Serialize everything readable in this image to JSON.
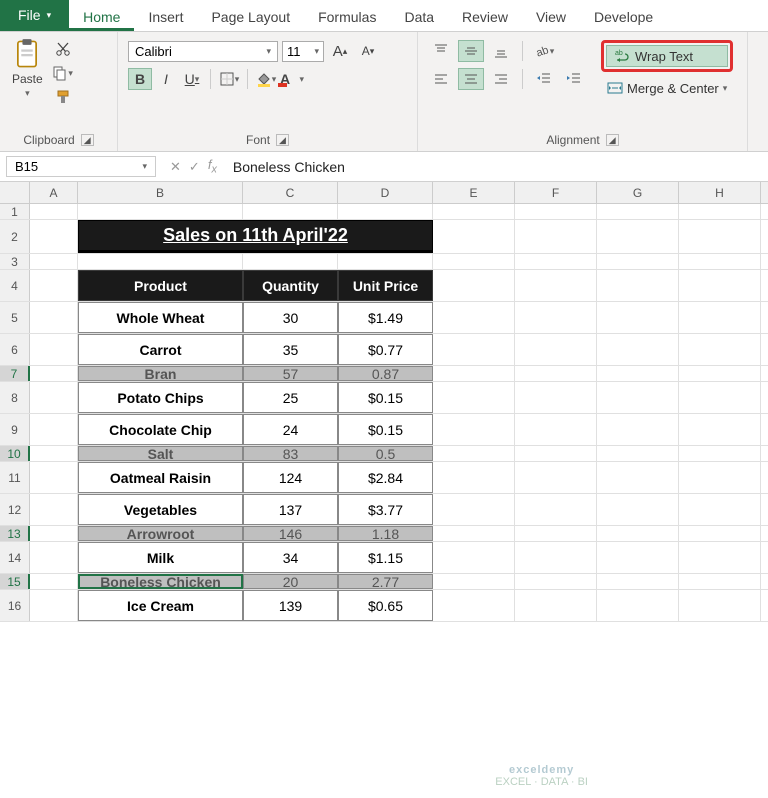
{
  "tabs": {
    "file": "File",
    "home": "Home",
    "insert": "Insert",
    "pagelayout": "Page Layout",
    "formulas": "Formulas",
    "data": "Data",
    "review": "Review",
    "view": "View",
    "developer": "Develope"
  },
  "ribbon": {
    "clipboard": {
      "paste": "Paste",
      "label": "Clipboard"
    },
    "font": {
      "name": "Calibri",
      "size": "11",
      "label": "Font"
    },
    "alignment": {
      "wrap": "Wrap Text",
      "merge": "Merge & Center",
      "label": "Alignment"
    }
  },
  "fbar": {
    "cellref": "B15",
    "formula": "Boneless Chicken"
  },
  "cols": [
    "A",
    "B",
    "C",
    "D",
    "E",
    "F",
    "G",
    "H"
  ],
  "title": "Sales on 11th April'22",
  "headers": {
    "product": "Product",
    "qty": "Quantity",
    "price": "Unit Price"
  },
  "rows": [
    {
      "n": 5,
      "product": "Whole Wheat",
      "qty": "30",
      "price": "$1.49",
      "hidden": false
    },
    {
      "n": 6,
      "product": "Carrot",
      "qty": "35",
      "price": "$0.77",
      "hidden": false
    },
    {
      "n": 7,
      "product": "Bran",
      "qty": "57",
      "price": "0.87",
      "hidden": true
    },
    {
      "n": 8,
      "product": "Potato Chips",
      "qty": "25",
      "price": "$0.15",
      "hidden": false
    },
    {
      "n": 9,
      "product": "Chocolate Chip",
      "qty": "24",
      "price": "$0.15",
      "hidden": false
    },
    {
      "n": 10,
      "product": "Salt",
      "qty": "83",
      "price": "0.5",
      "hidden": true
    },
    {
      "n": 11,
      "product": "Oatmeal Raisin",
      "qty": "124",
      "price": "$2.84",
      "hidden": false
    },
    {
      "n": 12,
      "product": "Vegetables",
      "qty": "137",
      "price": "$3.77",
      "hidden": false
    },
    {
      "n": 13,
      "product": "Arrowroot",
      "qty": "146",
      "price": "1.18",
      "hidden": true
    },
    {
      "n": 14,
      "product": "Milk",
      "qty": "34",
      "price": "$1.15",
      "hidden": false
    },
    {
      "n": 15,
      "product": "Boneless Chicken",
      "qty": "20",
      "price": "2.77",
      "hidden": true,
      "selected": true
    },
    {
      "n": 16,
      "product": "Ice Cream",
      "qty": "139",
      "price": "$0.65",
      "hidden": false
    }
  ],
  "watermark": {
    "l1": "exceldemy",
    "l2": "EXCEL · DATA · BI"
  }
}
